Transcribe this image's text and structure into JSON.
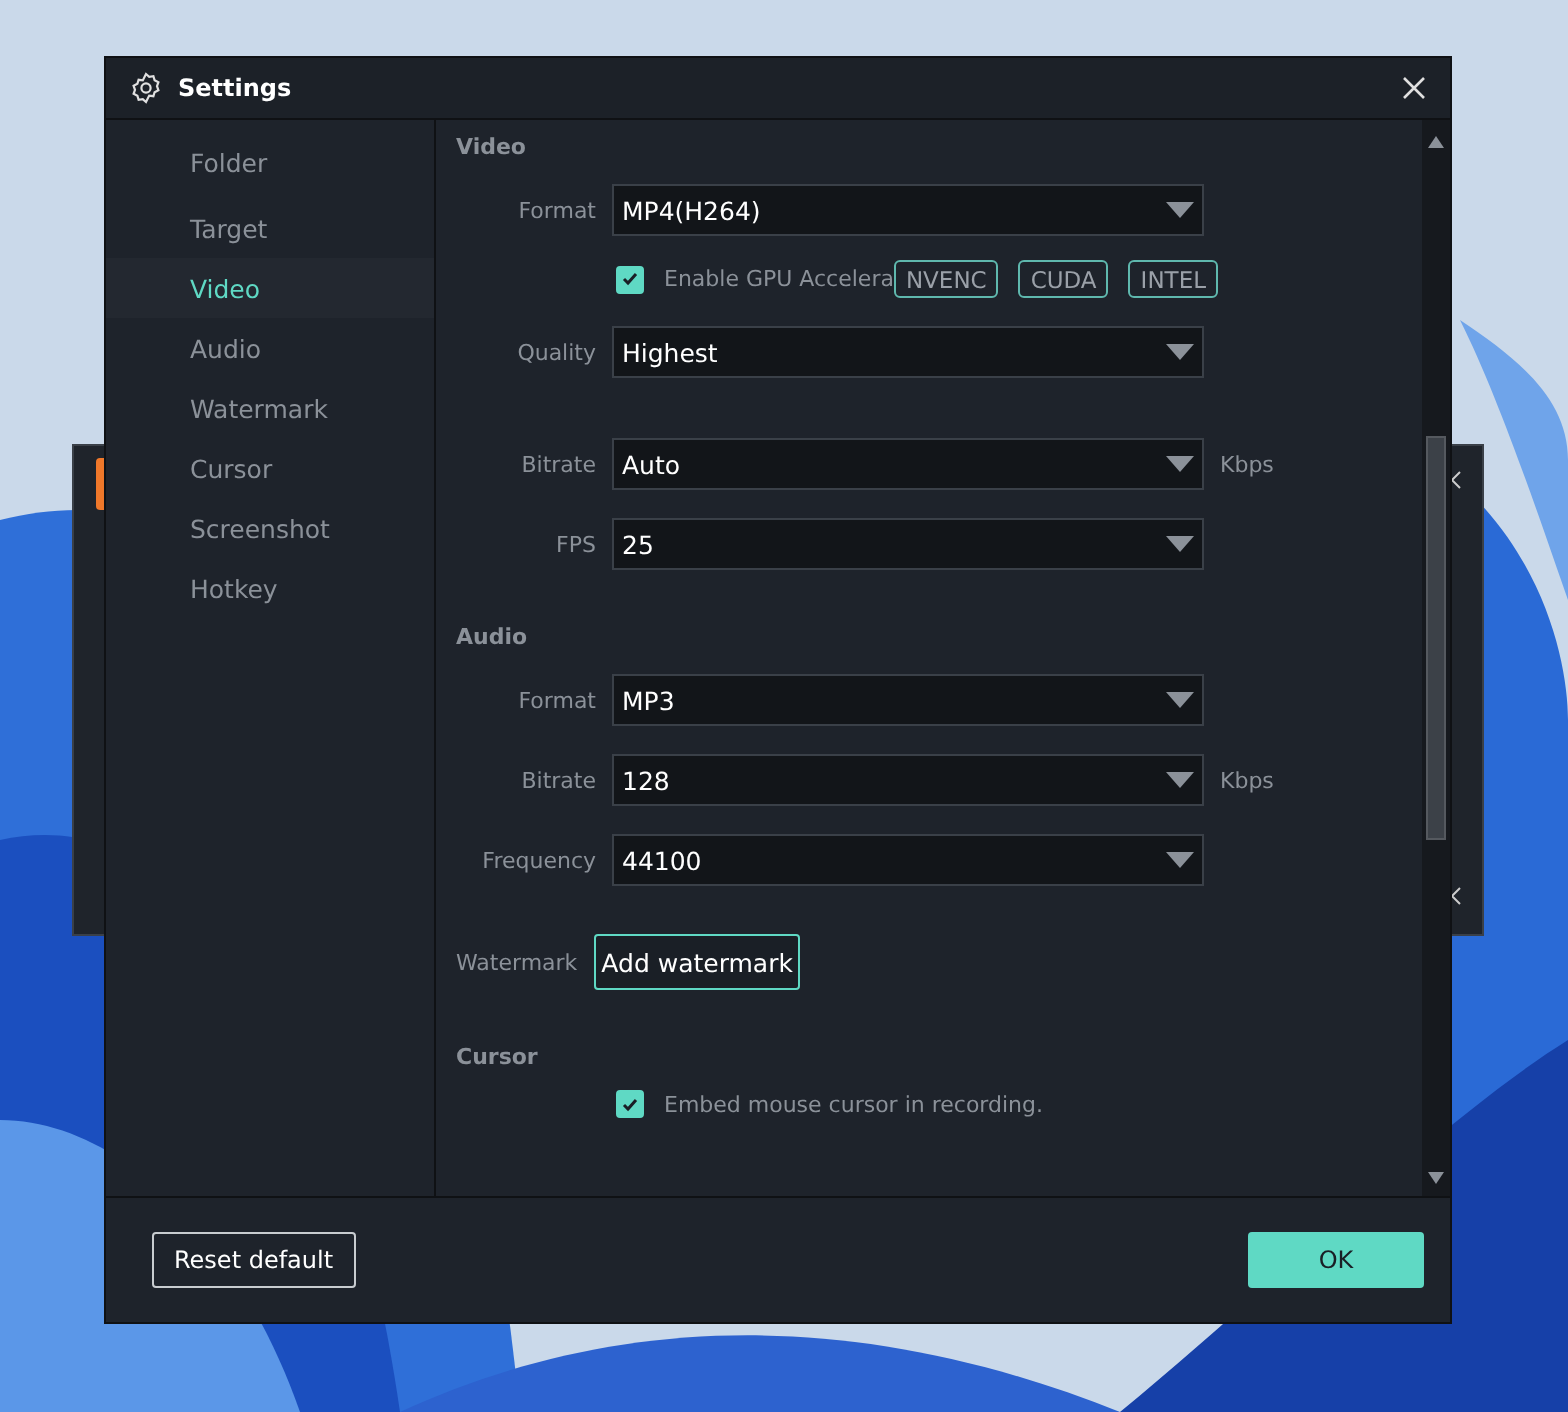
{
  "window": {
    "title": "Settings"
  },
  "sidebar": {
    "items": [
      {
        "label": "Folder",
        "selected": false
      },
      {
        "label": "Target",
        "selected": false
      },
      {
        "label": "Video",
        "selected": true
      },
      {
        "label": "Audio",
        "selected": false
      },
      {
        "label": "Watermark",
        "selected": false
      },
      {
        "label": "Cursor",
        "selected": false
      },
      {
        "label": "Screenshot",
        "selected": false
      },
      {
        "label": "Hotkey",
        "selected": false
      }
    ]
  },
  "sections": [
    {
      "title": "Video",
      "rows": [
        {
          "kind": "select",
          "label": "Format",
          "value": "MP4(H264)"
        },
        {
          "kind": "checkbox",
          "label": "Enable GPU Accelera",
          "checked": true,
          "chips": [
            "NVENC",
            "CUDA",
            "INTEL"
          ]
        },
        {
          "kind": "select",
          "label": "Quality",
          "value": "Highest"
        },
        {
          "kind": "select",
          "label": "Bitrate",
          "value": "Auto",
          "unit": "Kbps"
        },
        {
          "kind": "select",
          "label": "FPS",
          "value": "25"
        }
      ]
    },
    {
      "title": "Audio",
      "rows": [
        {
          "kind": "select",
          "label": "Format",
          "value": "MP3"
        },
        {
          "kind": "select",
          "label": "Bitrate",
          "value": "128",
          "unit": "Kbps"
        },
        {
          "kind": "select",
          "label": "Frequency",
          "value": "44100"
        },
        {
          "kind": "button",
          "label": "Watermark",
          "value": "Add watermark"
        }
      ]
    },
    {
      "title": "Cursor",
      "rows": [
        {
          "kind": "checkbox",
          "label": "Embed mouse cursor in recording.",
          "checked": true
        }
      ]
    }
  ],
  "footer": {
    "reset": "Reset default",
    "ok": "OK"
  }
}
